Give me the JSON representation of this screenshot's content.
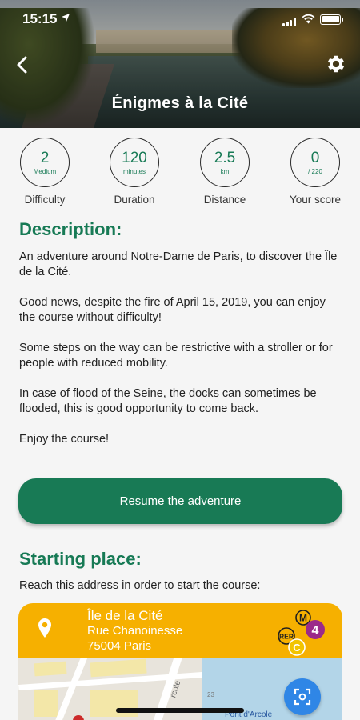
{
  "status_bar": {
    "time": "15:15"
  },
  "header": {
    "title": "Énigmes à la Cité"
  },
  "stats": [
    {
      "value": "2",
      "unit": "Medium",
      "caption": "Difficulty"
    },
    {
      "value": "120",
      "unit": "minutes",
      "caption": "Duration"
    },
    {
      "value": "2.5",
      "unit": "km",
      "caption": "Distance"
    },
    {
      "value": "0",
      "unit": "/ 220",
      "caption": "Your score"
    }
  ],
  "description": {
    "title": "Description:",
    "paragraphs": [
      "An adventure around Notre-Dame de Paris, to discover the Île de la Cité.",
      "Good news, despite the fire of April 15, 2019, you can enjoy the course without difficulty!",
      "Some steps on the way can be restrictive with a stroller or for people with reduced mobility.",
      "In case of flood of the Seine, the docks can sometimes be flooded, this is good opportunity to come back.",
      "Enjoy the course!"
    ]
  },
  "resume_button": {
    "label": "Resume the adventure"
  },
  "starting_place": {
    "title": "Starting place:",
    "instruction": "Reach this address in order to start the course:",
    "place": "Île de la Cité",
    "street": "Rue Chanoinesse",
    "city": "75004 Paris",
    "metro_line": "4",
    "metro_letter": "M",
    "rer_label": "RER",
    "rer_line": "C"
  },
  "map": {
    "road_label": "rcole",
    "bridge_label": "Pont d'Arcole",
    "building_number": "23"
  },
  "colors": {
    "accent": "#177a55",
    "card_header": "#f6b000",
    "metro_4": "#9b2a8a",
    "rer_c": "#f2c400",
    "scan_button": "#2f86e6"
  }
}
